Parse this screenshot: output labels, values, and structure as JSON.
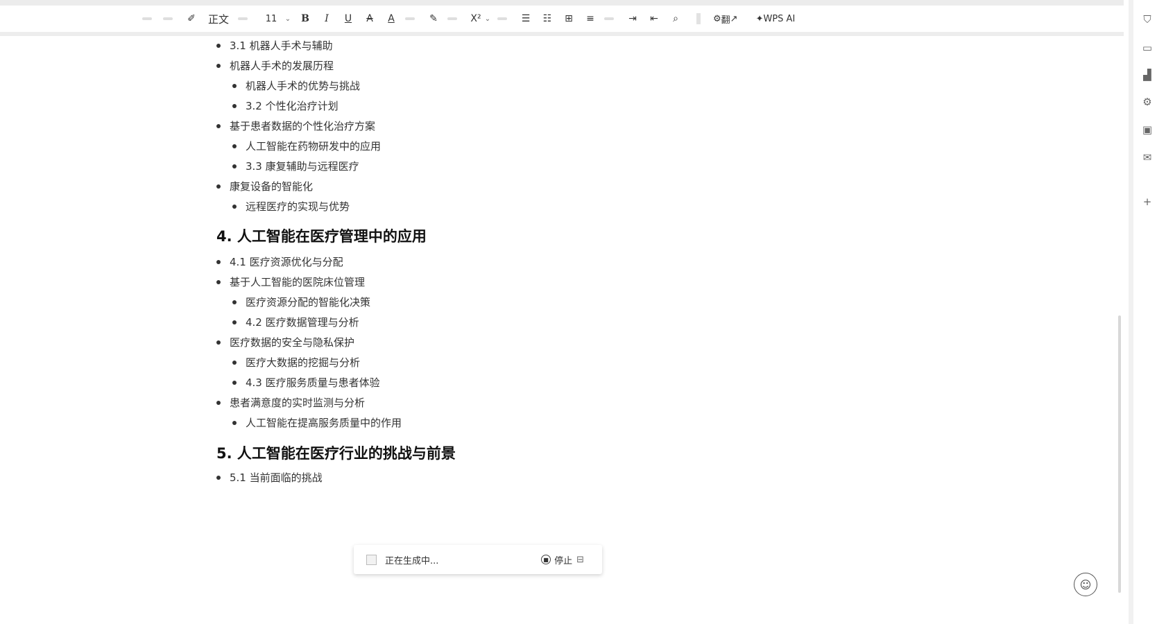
{
  "toolbar": {
    "style_label": "正文",
    "size_label": "11",
    "bold": "B",
    "italic": "I",
    "underline": "U",
    "strike": "A",
    "font_color": "A",
    "caret": "⌄",
    "ai_tool_label": "翻",
    "wps_ai_label": "WPS AI"
  },
  "outline": {
    "items_a": [
      {
        "text": "3.1 机器人手术与辅助"
      },
      {
        "text": "机器人手术的发展历程"
      },
      {
        "text": "机器人手术的优势与挑战"
      },
      {
        "text": "3.2 个性化治疗计划"
      },
      {
        "text": "基于患者数据的个性化治疗方案"
      },
      {
        "text": "人工智能在药物研发中的应用"
      },
      {
        "text": "3.3 康复辅助与远程医疗"
      },
      {
        "text": "康复设备的智能化"
      },
      {
        "text": "远程医疗的实现与优势"
      }
    ],
    "heading_4": "4. 人工智能在医疗管理中的应用",
    "items_b": [
      {
        "text": "4.1 医疗资源优化与分配"
      },
      {
        "text": "基于人工智能的医院床位管理"
      },
      {
        "text": "医疗资源分配的智能化决策"
      },
      {
        "text": "4.2 医疗数据管理与分析"
      },
      {
        "text": "医疗数据的安全与隐私保护"
      },
      {
        "text": "医疗大数据的挖掘与分析"
      },
      {
        "text": "4.3 医疗服务质量与患者体验"
      },
      {
        "text": "患者满意度的实时监测与分析"
      },
      {
        "text": "人工智能在提高服务质量中的作用"
      }
    ],
    "heading_5": "5. 人工智能在医疗行业的挑战与前景",
    "items_c": [
      {
        "text": "5.1 当前面临的挑战"
      }
    ]
  },
  "generation": {
    "status": "正在生成中...",
    "stop_label": "停止"
  }
}
